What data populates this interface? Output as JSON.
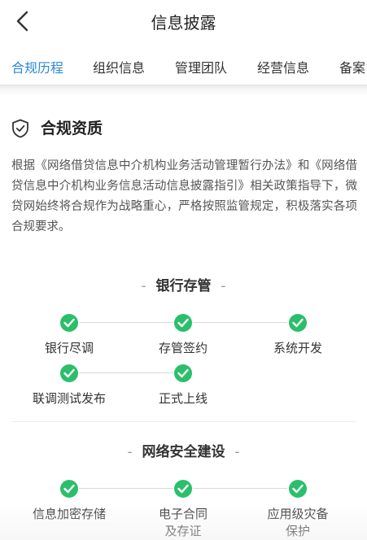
{
  "header": {
    "title": "信息披露"
  },
  "tabs": [
    {
      "label": "合规历程",
      "active": true
    },
    {
      "label": "组织信息",
      "active": false
    },
    {
      "label": "管理团队",
      "active": false
    },
    {
      "label": "经营信息",
      "active": false
    },
    {
      "label": "备案",
      "active": false
    }
  ],
  "section": {
    "title": "合规资质",
    "paragraph": "根据《网络借贷信息中介机构业务活动管理暂行办法》和《网络借贷信息中介机构业务信息活动信息披露指引》相关政策指导下，微贷网始终将合规作为战略重心，严格按照监管规定，积极落实各项合规要求。"
  },
  "groups": [
    {
      "title": "银行存管",
      "steps": [
        "银行尽调",
        "存管签约",
        "系统开发",
        "联调测试发布",
        "正式上线"
      ]
    },
    {
      "title": "网络安全建设",
      "steps": [
        "信息加密存储",
        "电子合同\n及存证",
        "应用级灾备\n保护"
      ]
    }
  ],
  "colors": {
    "accent": "#2b8ad8",
    "check": "#2bbf6b"
  },
  "icons": {
    "back": "chevron-left-icon",
    "shield": "shield-check-icon",
    "step": "check-circle-icon"
  }
}
